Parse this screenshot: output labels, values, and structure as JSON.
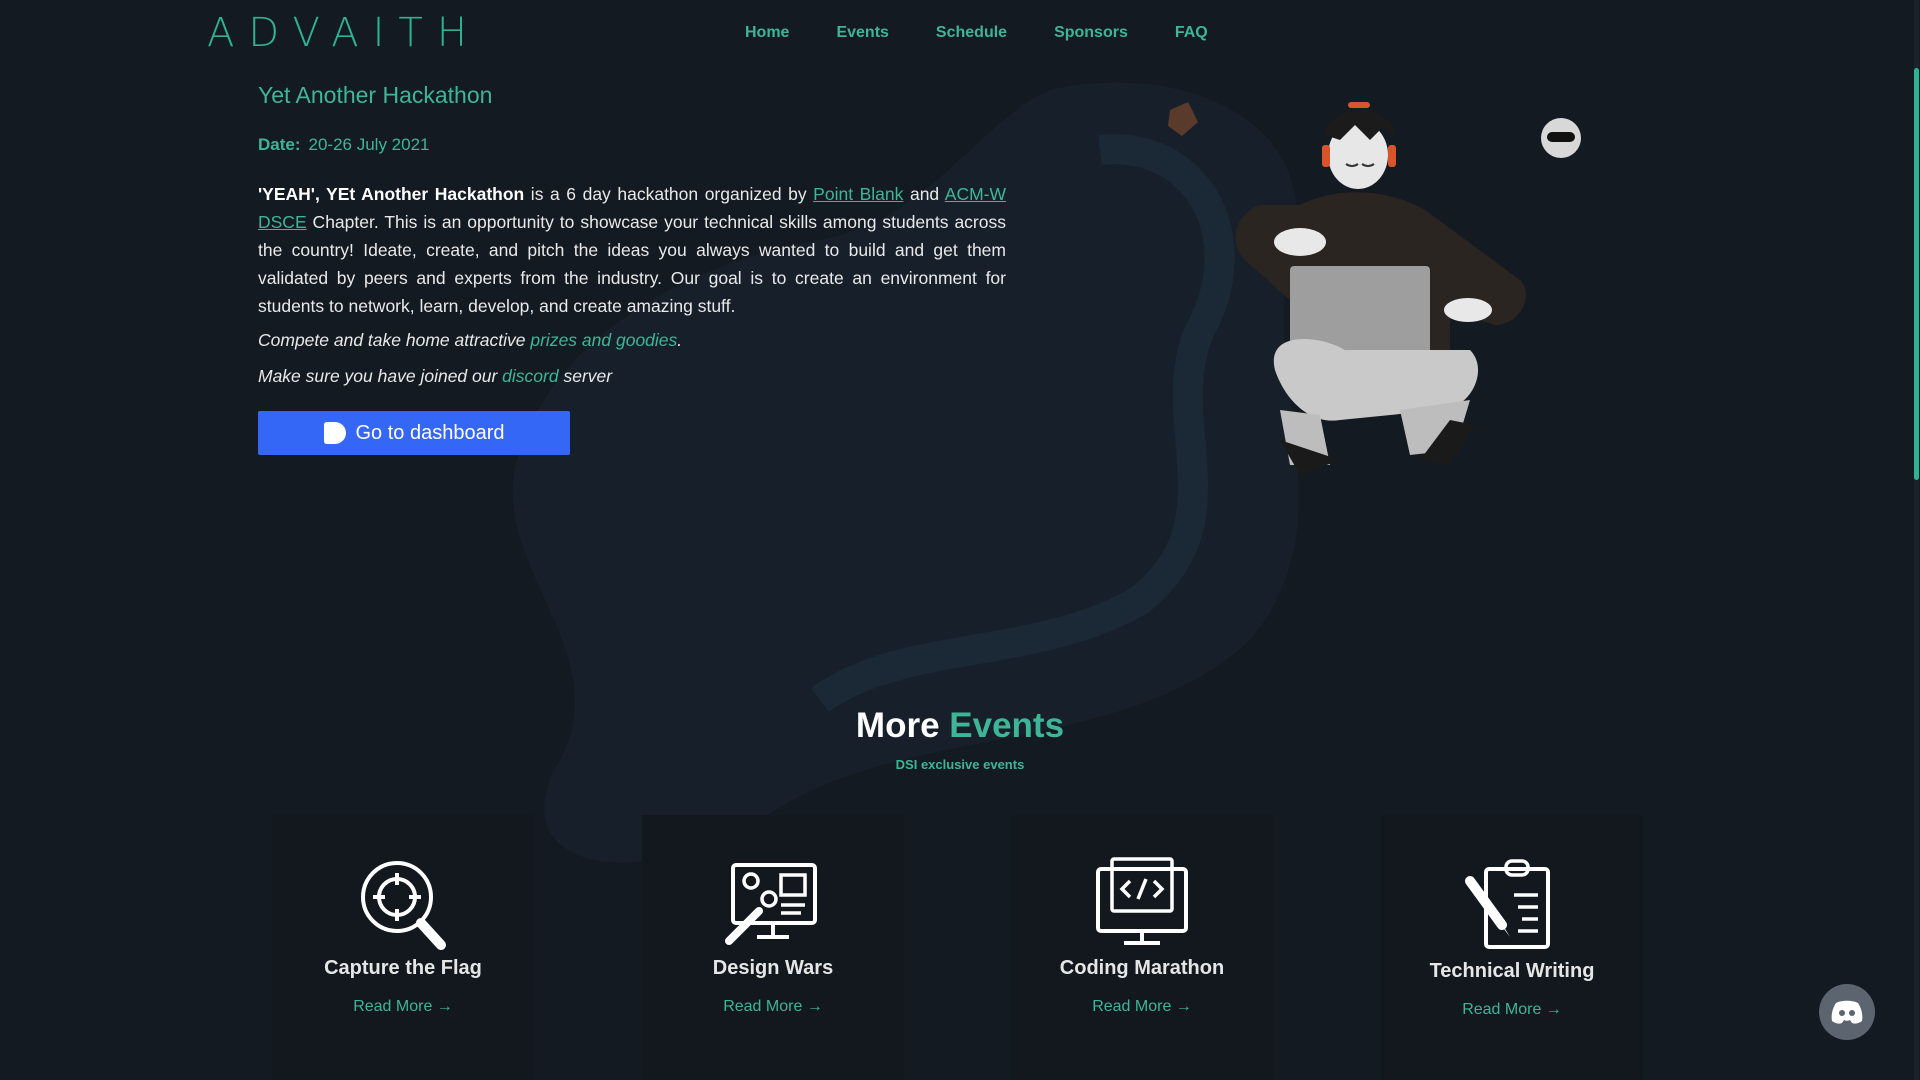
{
  "brand": {
    "logo_text": "ADVAITH"
  },
  "nav": [
    "Home",
    "Events",
    "Schedule",
    "Sponsors",
    "FAQ"
  ],
  "hero": {
    "title": "Yet Another Hackathon",
    "date_label": "Date:",
    "date_value": "20-26 July 2021",
    "desc_bold": "'YEAH', YEt Another Hackathon",
    "desc_part1": " is a 6 day hackathon organized by ",
    "link_point_blank": "Point Blank",
    "desc_and": " and ",
    "link_acm": "ACM-W DSCE",
    "desc_part2": " Chapter. This is an opportunity to showcase your technical skills among students across the country! Ideate, create, and pitch the ideas you always wanted to build and get them validated by peers and experts from the industry. Our goal is to create an environment for students to network, learn, develop, and create amazing stuff.",
    "compete_prefix": "Compete and take home attractive ",
    "compete_link": "prizes and goodies",
    "compete_suffix": ".",
    "discord_prefix": "Make sure you have joined our ",
    "discord_link": "discord",
    "discord_suffix": " server",
    "button_label": "Go to dashboard"
  },
  "more_events": {
    "title_white": "More",
    "title_green": "Events",
    "subtitle": "DSI exclusive events",
    "cards": [
      {
        "name": "Capture the Flag",
        "link": "Read More →",
        "icon": "search-target-icon"
      },
      {
        "name": "Design Wars",
        "link": "Read More →",
        "icon": "design-monitor-icon"
      },
      {
        "name": "Coding Marathon",
        "link": "Read More →",
        "icon": "code-monitor-icon"
      },
      {
        "name": "Technical Writing",
        "link": "Read More →",
        "icon": "clipboard-pen-icon"
      }
    ]
  },
  "colors": {
    "accent": "#3fb597",
    "button": "#3567f7",
    "background": "#131a21"
  }
}
